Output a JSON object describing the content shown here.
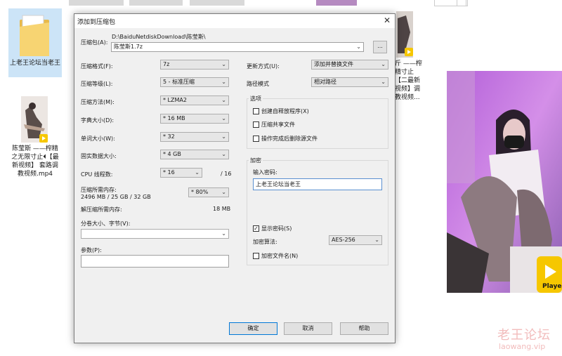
{
  "desktop": {
    "folder_label": "上老王论坛当老王",
    "file_left_label": "陈莹斯 ——榨精之无限寸止⏴【最新视频】 套路调教视频.mp4",
    "file_right_label": "斤 ——榨精寸止【二最新视频】调教视频...",
    "play_badge_text": "Player"
  },
  "dialog": {
    "title": "添加到压缩包",
    "archive_label": "压缩包(A):",
    "archive_path": "D:\\BaiduNetdiskDownload\\陈莹斯\\",
    "archive_name": "陈莹斯1.7z",
    "browse_label": "...",
    "left": {
      "format_label": "压缩格式(F):",
      "format_value": "7z",
      "level_label": "压缩等级(L):",
      "level_value": "5 - 标准压缩",
      "method_label": "压缩方法(M):",
      "method_value": "* LZMA2",
      "dict_label": "字典大小(D):",
      "dict_value": "* 16 MB",
      "word_label": "单词大小(W):",
      "word_value": "* 32",
      "solid_label": "固实数据大小:",
      "solid_value": "* 4 GB",
      "threads_label": "CPU 线程数:",
      "threads_value": "* 16",
      "threads_max": "/ 16",
      "mem_label": "压缩所需内存:",
      "mem_detail": "2496 MB / 25 GB / 32 GB",
      "mem_value": "* 80%",
      "decomp_label": "解压缩所需内存:",
      "decomp_value": "18 MB",
      "split_label": "分卷大小、字节(V):",
      "split_value": "",
      "params_label": "参数(P):",
      "params_value": ""
    },
    "right": {
      "update_label": "更新方式(U):",
      "update_value": "添加并替换文件",
      "path_label": "路径模式",
      "path_value": "相对路径",
      "options_title": "选项",
      "opt_sfx": "创建自释放程序(X)",
      "opt_shared": "压缩共享文件",
      "opt_delete": "操作完成后删除源文件",
      "encrypt_title": "加密",
      "password_label": "输入密码:",
      "password_value": "上老王论坛当老王",
      "show_password": "显示密码(S)",
      "enc_method_label": "加密算法:",
      "enc_method_value": "AES-256",
      "enc_filenames": "加密文件名(N)"
    },
    "buttons": {
      "ok": "确定",
      "cancel": "取消",
      "help": "帮助"
    }
  },
  "watermark": {
    "line1": "老王论坛",
    "line2": "laowang.vip"
  },
  "colors": {
    "selection": "#cce4f7",
    "dialog_bg": "#f0f0f0",
    "accent": "#0078d7",
    "badge": "#f6c700",
    "video_purple": "#c77ee0"
  }
}
